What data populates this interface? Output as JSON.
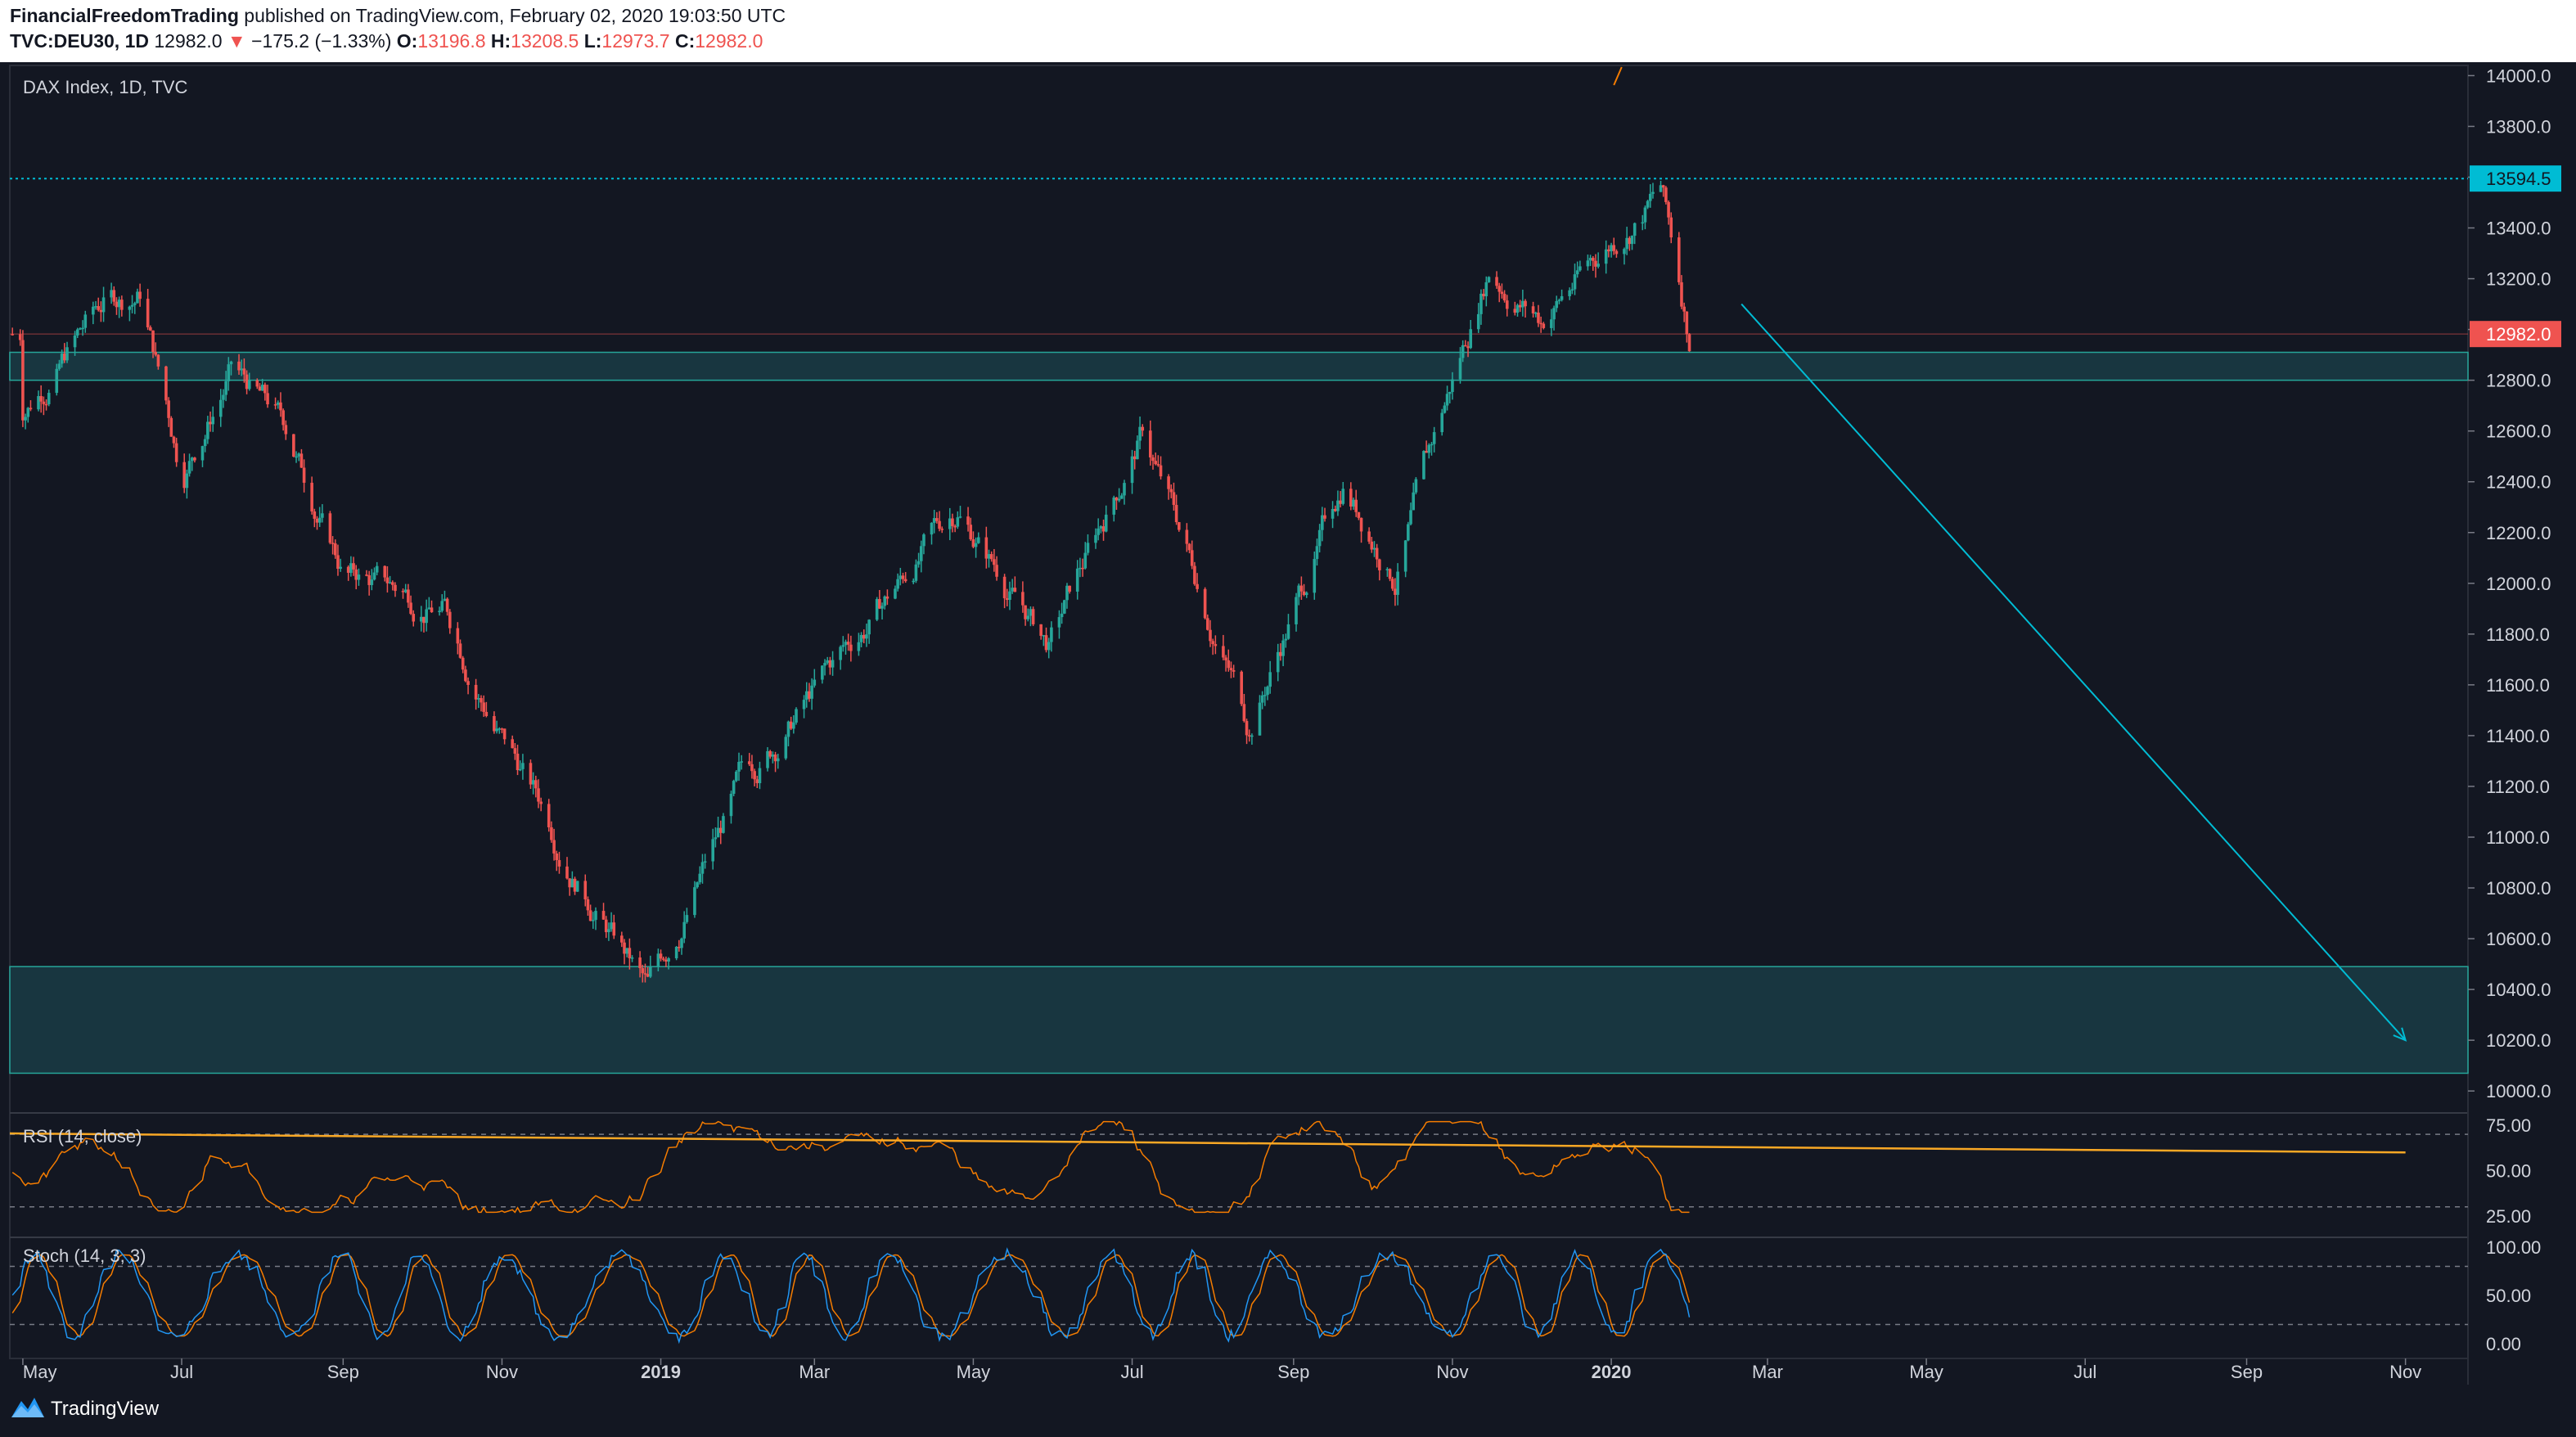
{
  "header": {
    "author": "FinancialFreedomTrading",
    "publish_text": "published on TradingView.com, February 02, 2020 19:03:50 UTC",
    "symbol_line": "TVC:DEU30, 1D",
    "last": "12982.0",
    "change": "−175.2 (−1.33%)",
    "open_label": "O:",
    "open": "13196.8",
    "high_label": "H:",
    "high": "13208.5",
    "low_label": "L:",
    "low": "12973.7",
    "close_label": "C:",
    "close": "12982.0"
  },
  "chart_data": [
    {
      "type": "candlestick",
      "title": "DAX Index, 1D, TVC",
      "y_ticks": [
        "14000.0",
        "13800.0",
        "13600.0",
        "13400.0",
        "13200.0",
        "13000.0",
        "12800.0",
        "12600.0",
        "12400.0",
        "12200.0",
        "12000.0",
        "11800.0",
        "11600.0",
        "11400.0",
        "11200.0",
        "11000.0",
        "10800.0",
        "10600.0",
        "10400.0",
        "10200.0",
        "10000.0"
      ],
      "ylim": [
        9920,
        14040
      ],
      "x_ticks": [
        "May",
        "Jul",
        "Sep",
        "Nov",
        "2019",
        "Mar",
        "May",
        "Jul",
        "Sep",
        "Nov",
        "2020",
        "Mar",
        "May",
        "Jul",
        "Sep",
        "Nov"
      ],
      "price_labels": {
        "dotted_level": "13594.5",
        "last_price": "12982.0"
      },
      "key_points": [
        {
          "date": "2018-05",
          "price": 12700
        },
        {
          "date": "2018-06-01",
          "price": 13100
        },
        {
          "date": "2018-06-15",
          "price": 13150
        },
        {
          "date": "2018-07-01",
          "price": 12450
        },
        {
          "date": "2018-07-20",
          "price": 12850
        },
        {
          "date": "2018-08-10",
          "price": 12600
        },
        {
          "date": "2018-09-01",
          "price": 12050
        },
        {
          "date": "2018-10-10",
          "price": 11900
        },
        {
          "date": "2018-11-01",
          "price": 11400
        },
        {
          "date": "2018-12-27",
          "price": 10380
        },
        {
          "date": "2019-02-01",
          "price": 11200
        },
        {
          "date": "2019-04-25",
          "price": 12300
        },
        {
          "date": "2019-05-30",
          "price": 11750
        },
        {
          "date": "2019-07-05",
          "price": 12600
        },
        {
          "date": "2019-08-15",
          "price": 11450
        },
        {
          "date": "2019-09-20",
          "price": 12400
        },
        {
          "date": "2019-10-10",
          "price": 12050
        },
        {
          "date": "2019-11-15",
          "price": 13250
        },
        {
          "date": "2019-12-05",
          "price": 13050
        },
        {
          "date": "2020-01-20",
          "price": 13560
        },
        {
          "date": "2020-01-31",
          "price": 12982
        }
      ],
      "annotations": {
        "support_zone_top": [
          12800,
          12910
        ],
        "support_zone_bottom": [
          10070,
          10490
        ],
        "horizontal_level": 13594.5,
        "projection_arrow": {
          "from_date": "2020-02-20",
          "from_price": 13100,
          "to_date": "2020-11-01",
          "to_price": 10200
        }
      }
    },
    {
      "type": "line",
      "title": "RSI (14, close)",
      "y_ticks": [
        "75.00",
        "50.00",
        "25.00"
      ],
      "ylim": [
        15,
        80
      ],
      "bands": [
        70,
        30
      ],
      "trendline": {
        "from_value": 70.5,
        "to_value": 60
      }
    },
    {
      "type": "line",
      "title": "Stoch (14, 3, 3)",
      "y_ticks": [
        "100.00",
        "50.00",
        "0.00"
      ],
      "ylim": [
        -15,
        110
      ],
      "bands": [
        80,
        20
      ]
    }
  ],
  "footer": {
    "brand": "TradingView"
  },
  "colors": {
    "background": "#131722",
    "up": "#26a69a",
    "down": "#ef5350",
    "zone": "#1a3a44",
    "zone_border": "#26a69a",
    "level_line": "#00bcd4",
    "rsi_line": "#f57c00",
    "rsi_trend": "#f9a825",
    "stoch_k": "#2196f3",
    "stoch_d": "#f57c00",
    "last_price_bg": "#ef5350",
    "level_bg": "#00bcd4"
  }
}
